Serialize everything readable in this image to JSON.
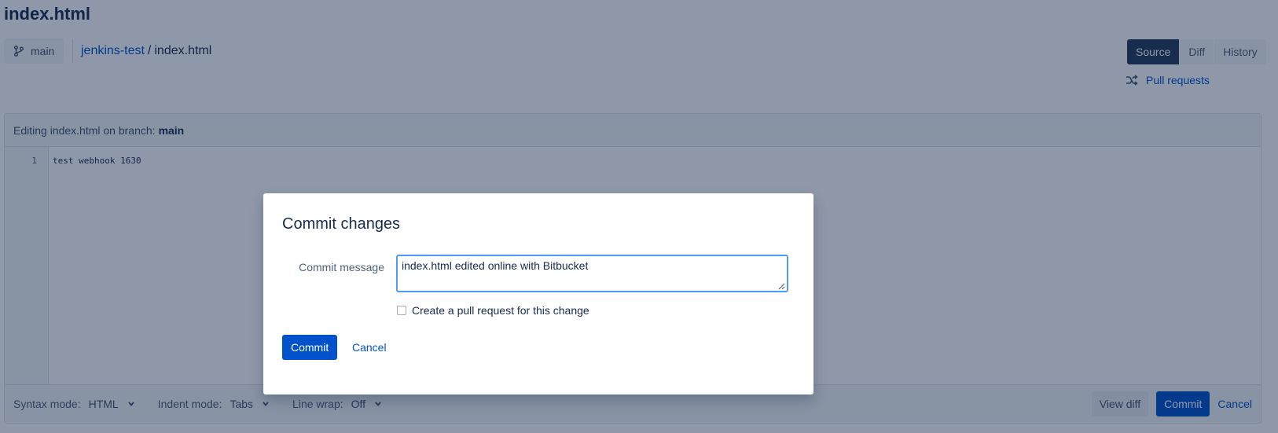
{
  "page": {
    "file_title": "index.html"
  },
  "branch": {
    "label": "main",
    "icon": "branch-icon"
  },
  "breadcrumb": {
    "repo": "jenkins-test",
    "separator": "/",
    "file": "index.html"
  },
  "view_tabs": [
    {
      "label": "Source",
      "active": true
    },
    {
      "label": "Diff",
      "active": false
    },
    {
      "label": "History",
      "active": false
    }
  ],
  "pull_requests": {
    "label": "Pull requests",
    "icon": "shuffle-icon"
  },
  "editor": {
    "header_prefix": "Editing index.html on branch:",
    "header_branch": "main",
    "lines": [
      {
        "number": "1",
        "text": "test webhook 1630"
      }
    ]
  },
  "footer": {
    "syntax_label": "Syntax mode:",
    "syntax_value": "HTML",
    "indent_label": "Indent mode:",
    "indent_value": "Tabs",
    "wrap_label": "Line wrap:",
    "wrap_value": "Off",
    "view_diff": "View diff",
    "commit": "Commit",
    "cancel": "Cancel"
  },
  "dialog": {
    "title": "Commit changes",
    "message_label": "Commit message",
    "message_value": "index.html edited online with Bitbucket",
    "create_pr_label": "Create a pull request for this change",
    "create_pr_checked": false,
    "commit_button": "Commit",
    "cancel_link": "Cancel"
  },
  "colors": {
    "primary": "#0052cc",
    "dark_tab": "#253858",
    "focus_border": "#4c9aff",
    "overlay": "rgba(9, 30, 66, 0.46)"
  }
}
